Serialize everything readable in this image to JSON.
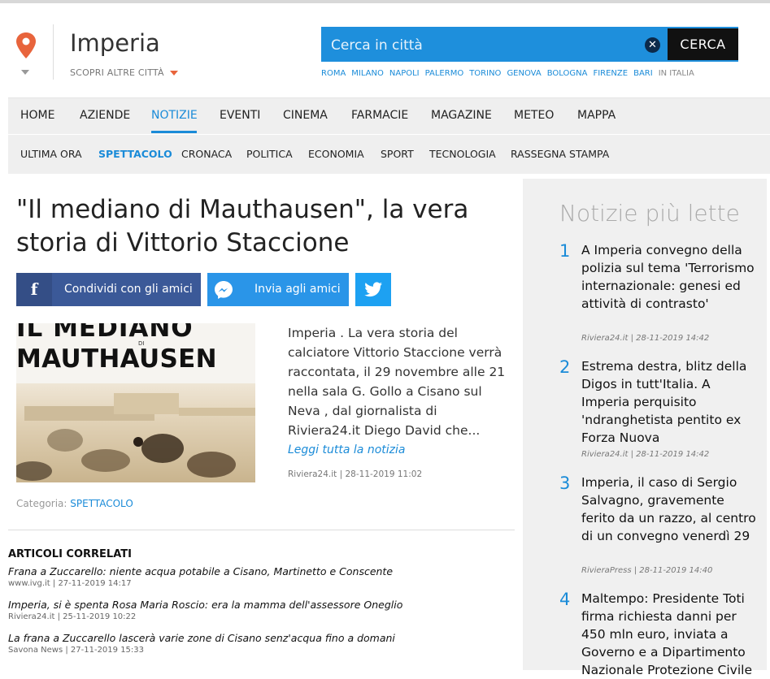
{
  "header": {
    "city": "Imperia",
    "discover_label": "SCOPRI ALTRE CITTÀ",
    "search_placeholder": "Cerca in città",
    "search_button": "CERCA",
    "cities": [
      "ROMA",
      "MILANO",
      "NAPOLI",
      "PALERMO",
      "TORINO",
      "GENOVA",
      "BOLOGNA",
      "FIRENZE",
      "BARI"
    ],
    "cities_more": "IN ITALIA",
    "accent_color": "#1a8bd8"
  },
  "mainnav": [
    "HOME",
    "AZIENDE",
    "NOTIZIE",
    "EVENTI",
    "CINEMA",
    "FARMACIE",
    "MAGAZINE",
    "METEO",
    "MAPPA"
  ],
  "mainnav_active": "NOTIZIE",
  "subnav": [
    "ULTIMA ORA",
    "SPETTACOLO",
    "CRONACA",
    "POLITICA",
    "ECONOMIA",
    "SPORT",
    "TECNOLOGIA",
    "RASSEGNA STAMPA"
  ],
  "subnav_active": "SPETTACOLO",
  "article": {
    "title": "\"Il mediano di Mauthausen\", la vera storia di Vittorio Staccione",
    "share_facebook": "Condividi con gli amici",
    "share_messenger": "Invia agli amici",
    "image_line1": "IL MEDIANO",
    "image_di": "DI",
    "image_line2": "MAUTHAUSEN",
    "excerpt": "Imperia . La vera storia del calciatore  Vittorio Staccione verrà raccontata, il 29 novembre alle 21 nella sala G. Gollo a Cisano sul Neva , dal giornalista di Riviera24.it Diego David che...",
    "read_more": "Leggi tutta la notizia",
    "source": "Riviera24.it | 28-11-2019 11:02",
    "category_label": "Categoria:",
    "category": "SPETTACOLO"
  },
  "related": {
    "heading": "ARTICOLI CORRELATI",
    "items": [
      {
        "title": "Frana a Zuccarello: niente acqua potabile a Cisano, Martinetto e Conscente",
        "meta": "www.ivg.it | 27-11-2019 14:17"
      },
      {
        "title": "Imperia, si è spenta Rosa Maria Roscio: era la mamma dell'assessore Oneglio",
        "meta": "Riviera24.it | 25-11-2019 10:22"
      },
      {
        "title": "La frana a Zuccarello lascerà varie zone di Cisano senz'acqua fino a domani",
        "meta": "Savona News | 27-11-2019 15:33"
      }
    ]
  },
  "popular": {
    "heading": "Notizie più lette",
    "items": [
      {
        "num": "1",
        "title": "A Imperia convegno della polizia sul tema 'Terrorismo internazionale: genesi ed attività di contrasto'",
        "meta": "Riviera24.it | 28-11-2019 14:42"
      },
      {
        "num": "2",
        "title": "Estrema destra, blitz della Digos in tutt'Italia. A Imperia perquisito 'ndranghetista pentito ex Forza Nuova",
        "meta": "Riviera24.it | 28-11-2019 14:42"
      },
      {
        "num": "3",
        "title": "Imperia, il caso di Sergio Salvagno, gravemente ferito da un razzo, al centro di un convegno venerdì 29",
        "meta": "RivieraPress | 28-11-2019 14:40"
      },
      {
        "num": "4",
        "title": "Maltempo: Presidente Toti firma richiesta danni per 450 mln euro, inviata a Governo e a Dipartimento Nazionale Protezione Civile",
        "meta": ""
      }
    ]
  }
}
